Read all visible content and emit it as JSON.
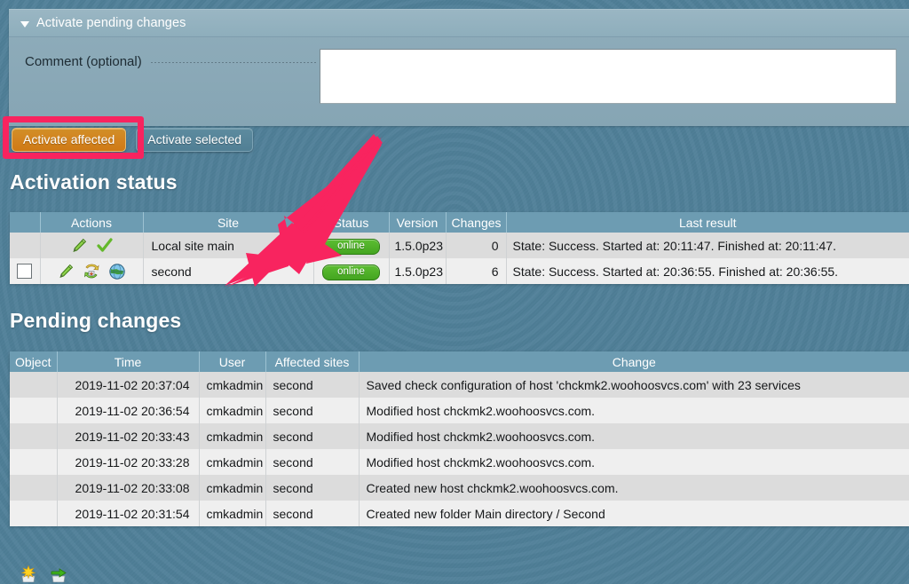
{
  "form": {
    "header_title": "Activate pending changes",
    "comment_label": "Comment (optional)",
    "comment_value": "",
    "comment_placeholder": ""
  },
  "buttons": {
    "activate_affected": "Activate affected",
    "activate_selected": "Activate selected"
  },
  "sections": {
    "activation_status_title": "Activation status",
    "pending_changes_title": "Pending changes"
  },
  "activation_status": {
    "columns": [
      "",
      "Actions",
      "Site",
      "Status",
      "Version",
      "Changes",
      "Last result"
    ],
    "rows": [
      {
        "checkbox": false,
        "actions": [
          "pencil-icon",
          "check-icon"
        ],
        "site": "Local site main",
        "status": "online",
        "version": "1.5.0p23",
        "changes": "0",
        "last_result": "State: Success. Started at: 20:11:47. Finished at: 20:11:47."
      },
      {
        "checkbox": true,
        "actions": [
          "pencil-icon",
          "restore-icon",
          "globe-icon"
        ],
        "site": "second",
        "status": "online",
        "version": "1.5.0p23",
        "changes": "6",
        "last_result": "State: Success. Started at: 20:36:55. Finished at: 20:36:55."
      }
    ]
  },
  "pending_changes": {
    "columns": [
      "Object",
      "Time",
      "User",
      "Affected sites",
      "Change"
    ],
    "rows": [
      {
        "object": "",
        "time": "2019-11-02 20:37:04",
        "user": "cmkadmin",
        "sites": "second",
        "change": "Saved check configuration of host 'chckmk2.woohoosvcs.com' with 23 services"
      },
      {
        "object": "",
        "time": "2019-11-02 20:36:54",
        "user": "cmkadmin",
        "sites": "second",
        "change": "Modified host chckmk2.woohoosvcs.com."
      },
      {
        "object": "",
        "time": "2019-11-02 20:33:43",
        "user": "cmkadmin",
        "sites": "second",
        "change": "Modified host chckmk2.woohoosvcs.com."
      },
      {
        "object": "",
        "time": "2019-11-02 20:33:28",
        "user": "cmkadmin",
        "sites": "second",
        "change": "Modified host chckmk2.woohoosvcs.com."
      },
      {
        "object": "",
        "time": "2019-11-02 20:33:08",
        "user": "cmkadmin",
        "sites": "second",
        "change": "Created new host chckmk2.woohoosvcs.com."
      },
      {
        "object": "",
        "time": "2019-11-02 20:31:54",
        "user": "cmkadmin",
        "sites": "second",
        "change": "Created new folder Main directory / Second"
      }
    ]
  },
  "footer": {
    "icons": [
      "new-item-icon",
      "green-arrow-icon"
    ]
  },
  "annotations": {
    "highlight_color": "#f8245f",
    "arrow_color": "#f8245f",
    "arrow_target": "second"
  },
  "colors": {
    "page_background": "#4f7f98",
    "panel_background": "#8fadbb",
    "table_header": "#6d9cb2",
    "row_odd": "#dcdcdc",
    "row_even": "#efefef",
    "accent_orange": "#d2831f",
    "status_green": "#4ba823"
  }
}
